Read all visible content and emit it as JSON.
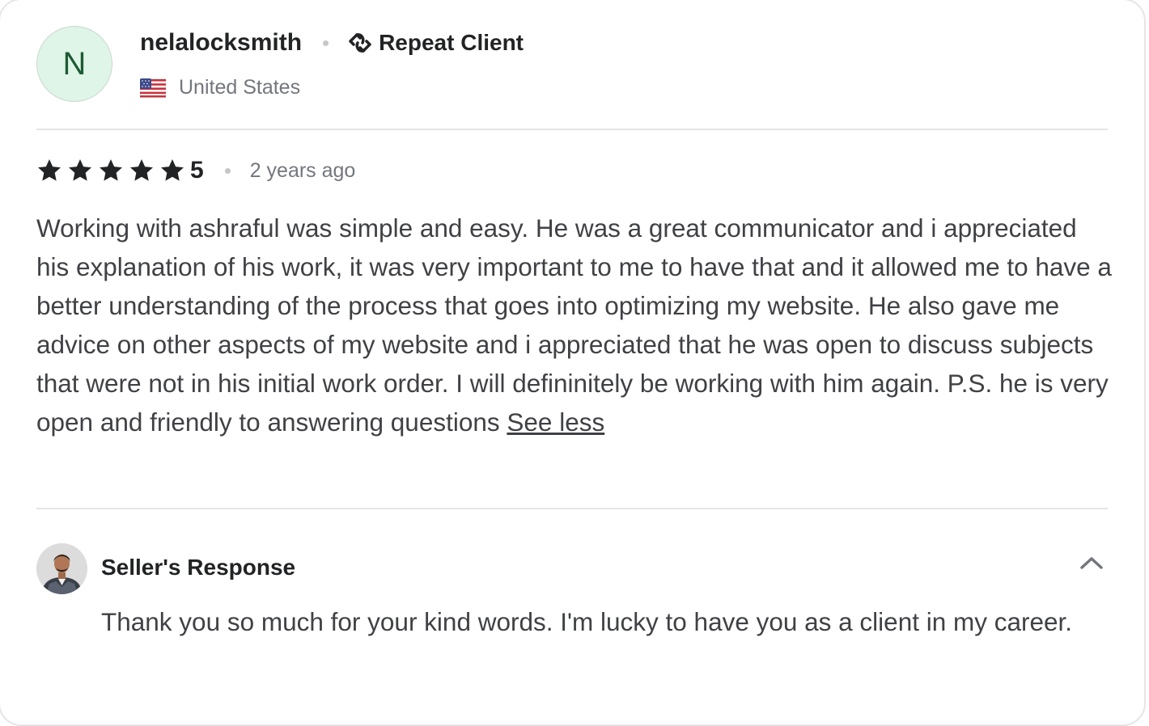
{
  "reviewer": {
    "initial": "N",
    "username": "nelalocksmith",
    "badge_label": "Repeat Client",
    "badge_icon": "repeat-icon",
    "country": "United States",
    "flag_icon": "us-flag-icon"
  },
  "rating": {
    "stars": 5,
    "value": "5",
    "time_ago": "2 years ago"
  },
  "review": {
    "text": "Working with ashraful was simple and easy. He was a great communicator and i appreciated his explanation of his work, it was very important to me to have that and it allowed me to have a better understanding of the process that goes into optimizing my website. He also gave me advice on other aspects of my website and i appreciated that he was open to discuss subjects that were not in his initial work order. I will defininitely be working with him again. P.S. he is very open and friendly to answering questions",
    "toggle_label": "See less"
  },
  "seller_response": {
    "title": "Seller's Response",
    "text": "Thank you so much for your kind words. I'm lucky to have you as a client in my career.",
    "collapse_icon": "chevron-up-icon"
  },
  "colors": {
    "avatar_bg": "#dff5e8",
    "avatar_text": "#1e5a34",
    "text_primary": "#222325",
    "text_body": "#404145",
    "text_muted": "#74767e",
    "divider": "#e4e5e7"
  }
}
